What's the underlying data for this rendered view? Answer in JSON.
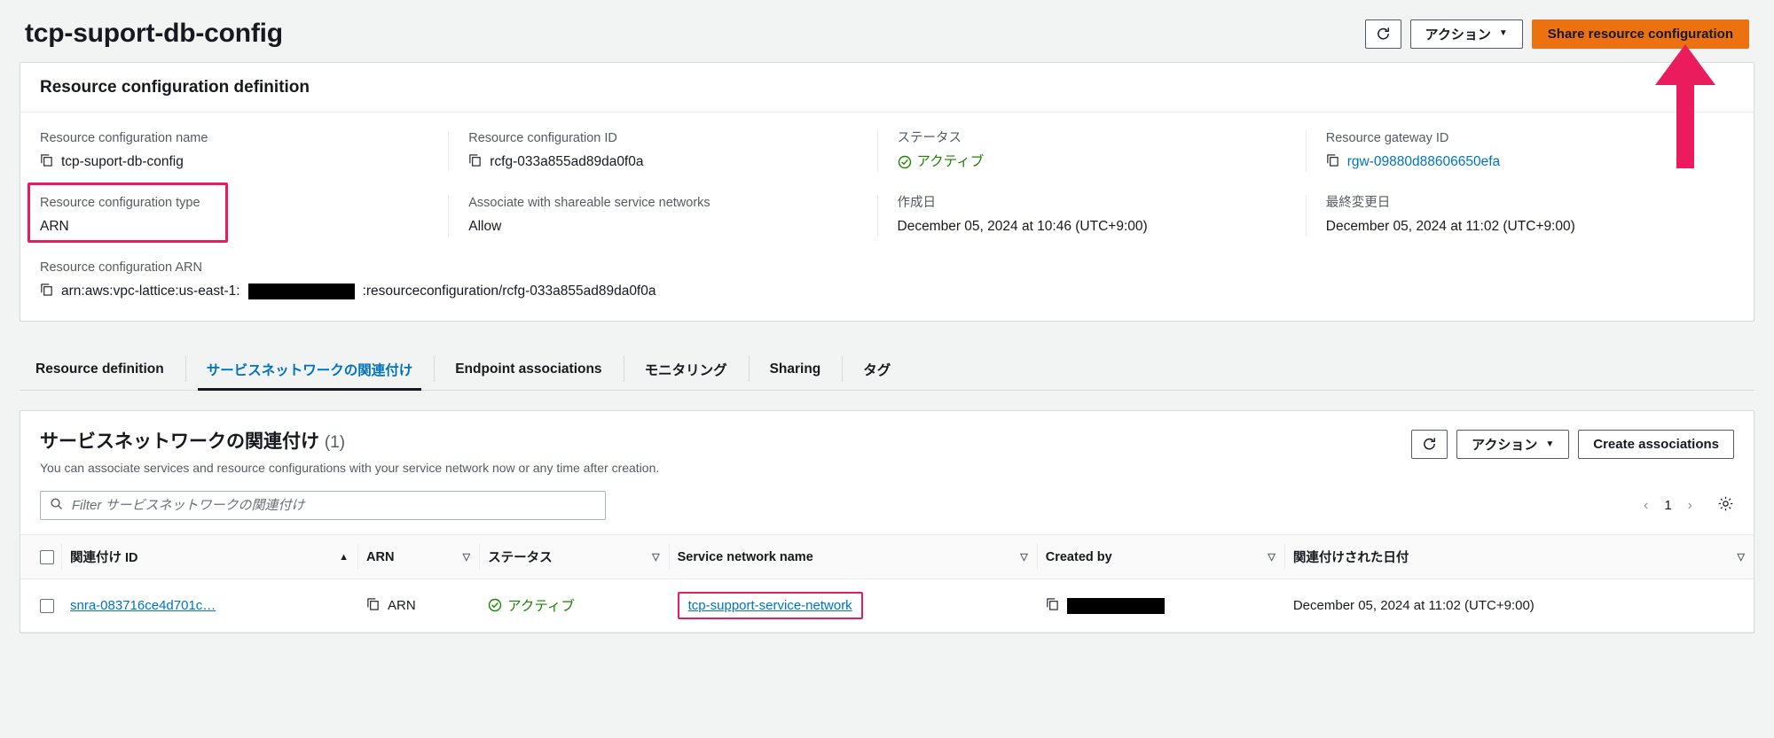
{
  "header": {
    "title": "tcp-suport-db-config",
    "refresh_icon": "refresh-icon",
    "actions_label": "アクション",
    "actions_caret": "▼",
    "share_label": "Share resource configuration"
  },
  "definition_panel": {
    "heading": "Resource configuration definition",
    "fields": {
      "name_label": "Resource configuration name",
      "name_value": "tcp-suport-db-config",
      "id_label": "Resource configuration ID",
      "id_value": "rcfg-033a855ad89da0f0a",
      "status_label": "ステータス",
      "status_value": "アクティブ",
      "gateway_label": "Resource gateway ID",
      "gateway_value": "rgw-09880d88606650efa",
      "type_label": "Resource configuration type",
      "type_value": "ARN",
      "associate_label": "Associate with shareable service networks",
      "associate_value": "Allow",
      "created_label": "作成日",
      "created_value": "December 05, 2024 at 10:46 (UTC+9:00)",
      "modified_label": "最終変更日",
      "modified_value": "December 05, 2024 at 11:02 (UTC+9:00)",
      "arn_label": "Resource configuration ARN",
      "arn_prefix": "arn:aws:vpc-lattice:us-east-1:",
      "arn_suffix": ":resourceconfiguration/rcfg-033a855ad89da0f0a"
    }
  },
  "tabs": [
    {
      "label": "Resource definition",
      "active": false
    },
    {
      "label": "サービスネットワークの関連付け",
      "active": true
    },
    {
      "label": "Endpoint associations",
      "active": false
    },
    {
      "label": "モニタリング",
      "active": false
    },
    {
      "label": "Sharing",
      "active": false
    },
    {
      "label": "タグ",
      "active": false
    }
  ],
  "table_section": {
    "title": "サービスネットワークの関連付け",
    "count": "(1)",
    "description": "You can associate services and resource configurations with your service network now or any time after creation.",
    "refresh_icon": "refresh-icon",
    "actions_label": "アクション",
    "actions_caret": "▼",
    "create_label": "Create associations",
    "filter_placeholder": "Filter サービスネットワークの関連付け",
    "page_number": "1",
    "prev_arrow": "‹",
    "next_arrow": "›",
    "settings_icon": "gear-icon",
    "columns": [
      {
        "label": "関連付け ID",
        "sort": "▲"
      },
      {
        "label": "ARN",
        "sort": "▽"
      },
      {
        "label": "ステータス",
        "sort": "▽"
      },
      {
        "label": "Service network name",
        "sort": "▽"
      },
      {
        "label": "Created by",
        "sort": "▽"
      },
      {
        "label": "関連付けされた日付",
        "sort": "▽"
      }
    ],
    "rows": [
      {
        "association_id": "snra-083716ce4d701c…",
        "arn": "ARN",
        "status": "アクティブ",
        "service_network_name": "tcp-support-service-network",
        "created_by": "",
        "associated_date": "December 05, 2024 at 11:02 (UTC+9:00)"
      }
    ]
  },
  "colors": {
    "accent_orange": "#ec7211",
    "link_blue": "#0073bb",
    "status_green": "#1d8102",
    "annotation_pink": "#eb1c5d"
  }
}
